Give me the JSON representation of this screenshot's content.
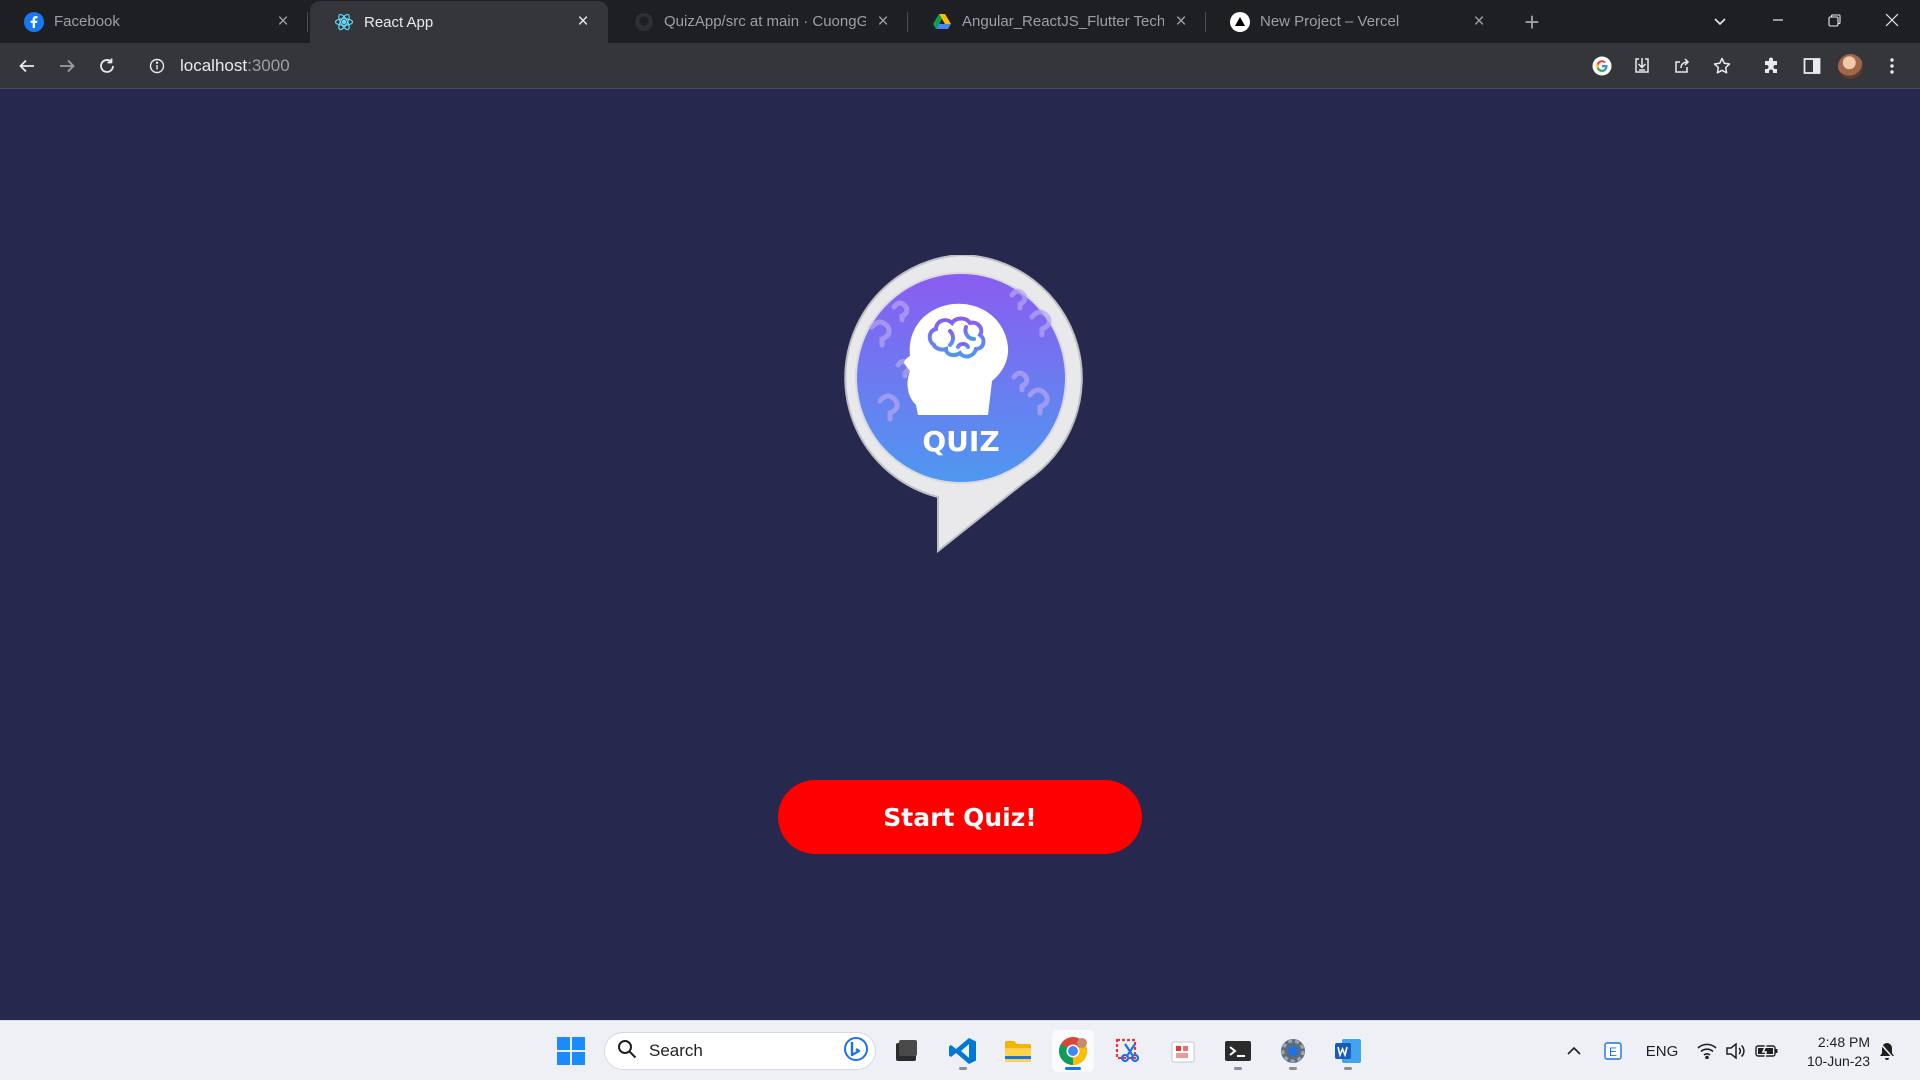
{
  "browser": {
    "tabs": [
      {
        "title": "Facebook",
        "favicon": "facebook-icon",
        "active": false
      },
      {
        "title": "React App",
        "favicon": "react-icon",
        "active": true
      },
      {
        "title": "QuizApp/src at main · CuongGo",
        "favicon": "github-icon",
        "active": false
      },
      {
        "title": "Angular_ReactJS_Flutter Technica",
        "favicon": "google-drive-icon",
        "active": false
      },
      {
        "title": "New Project – Vercel",
        "favicon": "vercel-icon",
        "active": false
      }
    ],
    "address": {
      "host": "localhost",
      "port": ":3000"
    },
    "toolbar_icons": [
      "google-icon",
      "install-icon",
      "share-icon",
      "bookmark-star-icon",
      "extensions-icon",
      "side-panel-icon",
      "profile-avatar",
      "menu-icon"
    ]
  },
  "page": {
    "logo_text": "QUIZ",
    "start_button_label": "Start Quiz!"
  },
  "taskbar": {
    "search_placeholder": "Search",
    "apps": [
      "windows-start-icon",
      "task-view-icon",
      "vscode-icon",
      "file-explorer-icon",
      "chrome-icon",
      "snipping-tool-icon",
      "paint-icon",
      "terminal-icon",
      "settings-icon",
      "word-icon"
    ],
    "tray": {
      "language": "ENG",
      "time": "2:48 PM",
      "date": "10-Jun-23"
    }
  },
  "colors": {
    "page_background": "#26284d",
    "button": "#ff0000",
    "logo_gradient_top": "#8a5cf0",
    "logo_gradient_bottom": "#4f98f0"
  }
}
